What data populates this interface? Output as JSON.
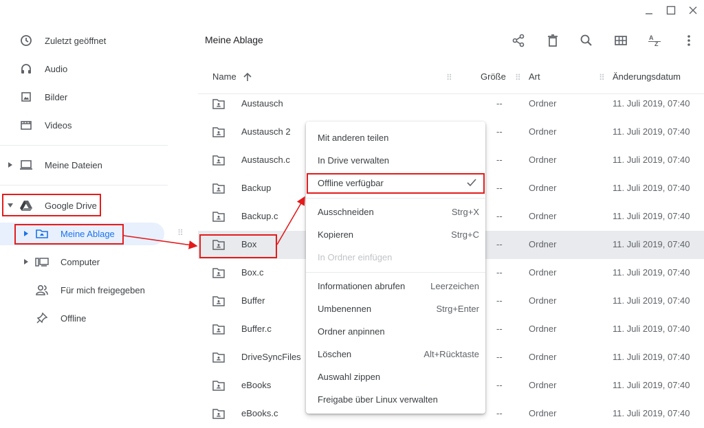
{
  "window_controls": {
    "minimize_icon": "minimize-icon",
    "maximize_icon": "maximize-icon",
    "close_icon": "close-icon"
  },
  "sidebar": {
    "recent": {
      "label": "Zuletzt geöffnet",
      "icon": "clock-icon"
    },
    "audio": {
      "label": "Audio",
      "icon": "headphones-icon"
    },
    "images": {
      "label": "Bilder",
      "icon": "image-icon"
    },
    "videos": {
      "label": "Videos",
      "icon": "film-icon"
    },
    "my_files": {
      "label": "Meine Dateien",
      "icon": "laptop-icon"
    },
    "google_drive": {
      "label": "Google Drive",
      "icon": "google-drive-icon"
    },
    "my_drive": {
      "label": "Meine Ablage",
      "icon": "folder-drive-icon"
    },
    "computers": {
      "label": "Computer",
      "icon": "computers-icon"
    },
    "shared": {
      "label": "Für mich freigegeben",
      "icon": "people-icon"
    },
    "offline": {
      "label": "Offline",
      "icon": "pin-icon"
    }
  },
  "header": {
    "title": "Meine Ablage"
  },
  "toolbar": [
    "share-icon",
    "delete-icon",
    "search-icon",
    "grid-view-icon",
    "sort-az-icon",
    "more-vert-icon"
  ],
  "columns": {
    "name": "Name",
    "size": "Größe",
    "type": "Art",
    "date": "Änderungsdatum"
  },
  "files": [
    {
      "name": "Austausch",
      "size": "--",
      "type": "Ordner",
      "date": "11. Juli 2019, 07:40"
    },
    {
      "name": "Austausch 2",
      "size": "--",
      "type": "Ordner",
      "date": "11. Juli 2019, 07:40"
    },
    {
      "name": "Austausch.c",
      "size": "--",
      "type": "Ordner",
      "date": "11. Juli 2019, 07:40"
    },
    {
      "name": "Backup",
      "size": "--",
      "type": "Ordner",
      "date": "11. Juli 2019, 07:40"
    },
    {
      "name": "Backup.c",
      "size": "--",
      "type": "Ordner",
      "date": "11. Juli 2019, 07:40"
    },
    {
      "name": "Box",
      "size": "--",
      "type": "Ordner",
      "date": "11. Juli 2019, 07:40"
    },
    {
      "name": "Box.c",
      "size": "--",
      "type": "Ordner",
      "date": "11. Juli 2019, 07:40"
    },
    {
      "name": "Buffer",
      "size": "--",
      "type": "Ordner",
      "date": "11. Juli 2019, 07:40"
    },
    {
      "name": "Buffer.c",
      "size": "--",
      "type": "Ordner",
      "date": "11. Juli 2019, 07:40"
    },
    {
      "name": "DriveSyncFiles",
      "size": "--",
      "type": "Ordner",
      "date": "11. Juli 2019, 07:40"
    },
    {
      "name": "eBooks",
      "size": "--",
      "type": "Ordner",
      "date": "11. Juli 2019, 07:40"
    },
    {
      "name": "eBooks.c",
      "size": "--",
      "type": "Ordner",
      "date": "11. Juli 2019, 07:40"
    }
  ],
  "context_menu": {
    "share": {
      "label": "Mit anderen teilen"
    },
    "manage_in_drive": {
      "label": "In Drive verwalten"
    },
    "offline": {
      "label": "Offline verfügbar",
      "checked": true
    },
    "cut": {
      "label": "Ausschneiden",
      "shortcut": "Strg+X"
    },
    "copy": {
      "label": "Kopieren",
      "shortcut": "Strg+C"
    },
    "paste": {
      "label": "In Ordner einfügen",
      "disabled": true
    },
    "info": {
      "label": "Informationen abrufen",
      "shortcut": "Leerzeichen"
    },
    "rename": {
      "label": "Umbenennen",
      "shortcut": "Strg+Enter"
    },
    "pin": {
      "label": "Ordner anpinnen"
    },
    "delete": {
      "label": "Löschen",
      "shortcut": "Alt+Rücktaste"
    },
    "zip": {
      "label": "Auswahl zippen"
    },
    "linux": {
      "label": "Freigabe über Linux verwalten"
    }
  },
  "colors": {
    "accent": "#1a73e8",
    "selected_nav_bg": "#e8f0fe",
    "selected_row_bg": "#e8eaed",
    "annotation": "#e31b1b"
  }
}
